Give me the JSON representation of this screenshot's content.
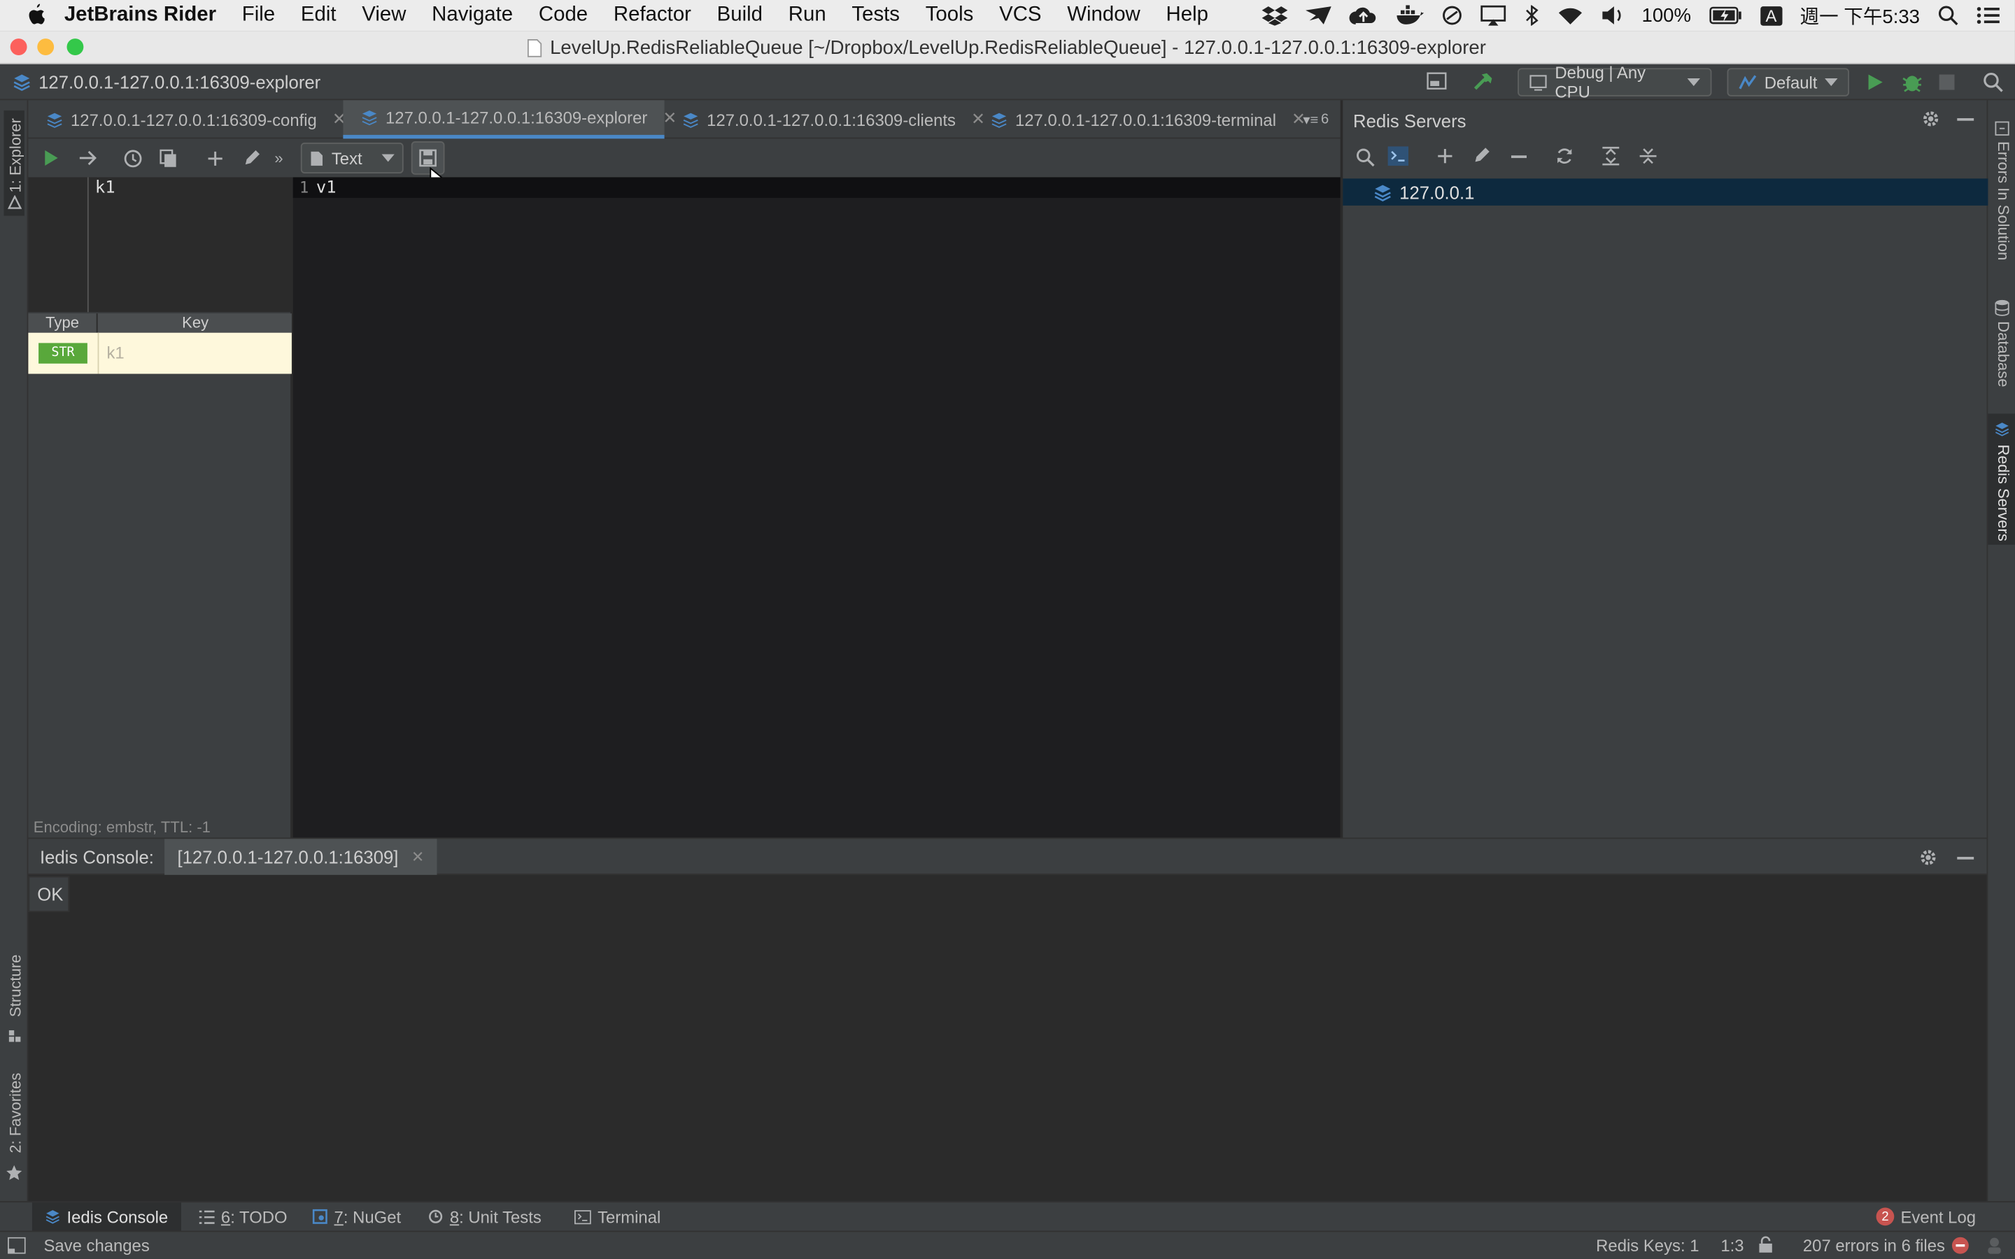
{
  "menubar": {
    "app": "JetBrains Rider",
    "items": [
      "File",
      "Edit",
      "View",
      "Navigate",
      "Code",
      "Refactor",
      "Build",
      "Run",
      "Tests",
      "Tools",
      "VCS",
      "Window",
      "Help"
    ],
    "battery": "100%",
    "input_method": "A",
    "clock": "週一 下午5:33"
  },
  "window": {
    "title": "LevelUp.RedisReliableQueue [~/Dropbox/LevelUp.RedisReliableQueue] - 127.0.0.1-127.0.0.1:16309-explorer"
  },
  "navbar": {
    "breadcrumb": "127.0.0.1-127.0.0.1:16309-explorer",
    "config_combo": "Debug | Any CPU",
    "run_target": "Default"
  },
  "left_strip": {
    "explorer": "1: Explorer",
    "structure": "Structure",
    "favorites": "2: Favorites"
  },
  "right_strip": {
    "errors": "Errors In Solution",
    "database": "Database",
    "redis": "Redis Servers"
  },
  "editor_tabs": [
    {
      "label": "127.0.0.1-127.0.0.1:16309-config"
    },
    {
      "label": "127.0.0.1-127.0.0.1:16309-explorer"
    },
    {
      "label": "127.0.0.1-127.0.0.1:16309-clients"
    },
    {
      "label": "127.0.0.1-127.0.0.1:16309-terminal"
    }
  ],
  "tabs_overflow": "6",
  "toolbar": {
    "format_label": "Text"
  },
  "explorer": {
    "selected_key": "k1",
    "columns": {
      "type": "Type",
      "key": "Key"
    },
    "rows": [
      {
        "type": "STR",
        "key": "k1"
      }
    ],
    "encoding": "Encoding: embstr, TTL: -1",
    "value_line_no": "1",
    "value_text": "v1"
  },
  "redis_servers": {
    "title": "Redis Servers",
    "host": "127.0.0.1"
  },
  "console": {
    "label": "Iedis Console:",
    "tab": "[127.0.0.1-127.0.0.1:16309]",
    "output": "OK"
  },
  "tool_windows": [
    {
      "label": "Iedis Console"
    },
    {
      "num": "6",
      "label": ": TODO"
    },
    {
      "num": "7",
      "label": ": NuGet"
    },
    {
      "num": "8",
      "label": ": Unit Tests"
    },
    {
      "label": "Terminal"
    }
  ],
  "event_log": {
    "count": "2",
    "label": "Event Log"
  },
  "statusbar": {
    "message": "Save changes",
    "redis_keys": "Redis Keys: 1",
    "position": "1:3",
    "errors": "207 errors in 6 files"
  },
  "colors": {
    "accent": "#4a88c7",
    "str_badge": "#59a83b",
    "run_green": "#499c54",
    "error_red": "#c75450"
  }
}
